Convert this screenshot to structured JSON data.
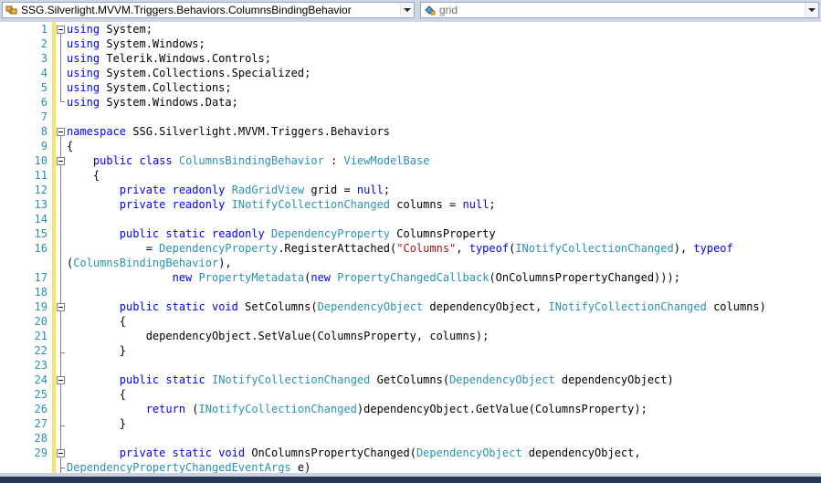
{
  "nav": {
    "type_combo": "SSG.Silverlight.MVVM.Triggers.Behaviors.ColumnsBindingBehavior",
    "member_combo": "grid"
  },
  "colors": {
    "keyword": "#0000ff",
    "type": "#2b91af",
    "string": "#a31515",
    "line_number": "#2b91af"
  },
  "lines": [
    {
      "n": "1",
      "code": [
        [
          "kw",
          "using"
        ],
        [
          "t",
          " System;"
        ]
      ]
    },
    {
      "n": "2",
      "code": [
        [
          "kw",
          "using"
        ],
        [
          "t",
          " System.Windows;"
        ]
      ]
    },
    {
      "n": "3",
      "code": [
        [
          "kw",
          "using"
        ],
        [
          "t",
          " Telerik.Windows.Controls;"
        ]
      ]
    },
    {
      "n": "4",
      "code": [
        [
          "kw",
          "using"
        ],
        [
          "t",
          " System.Collections.Specialized;"
        ]
      ]
    },
    {
      "n": "5",
      "code": [
        [
          "kw",
          "using"
        ],
        [
          "t",
          " System.Collections;"
        ]
      ]
    },
    {
      "n": "6",
      "code": [
        [
          "kw",
          "using"
        ],
        [
          "t",
          " System.Windows.Data;"
        ]
      ]
    },
    {
      "n": "7",
      "code": []
    },
    {
      "n": "8",
      "code": [
        [
          "kw",
          "namespace"
        ],
        [
          "t",
          " SSG.Silverlight.MVVM.Triggers.Behaviors"
        ]
      ]
    },
    {
      "n": "9",
      "code": [
        [
          "t",
          "{"
        ]
      ]
    },
    {
      "n": "10",
      "code": [
        [
          "t",
          "    "
        ],
        [
          "kw",
          "public"
        ],
        [
          "t",
          " "
        ],
        [
          "kw",
          "class"
        ],
        [
          "t",
          " "
        ],
        [
          "ty",
          "ColumnsBindingBehavior"
        ],
        [
          "t",
          " : "
        ],
        [
          "ty",
          "ViewModelBase"
        ]
      ]
    },
    {
      "n": "11",
      "code": [
        [
          "t",
          "    {"
        ]
      ]
    },
    {
      "n": "12",
      "code": [
        [
          "t",
          "        "
        ],
        [
          "kw",
          "private"
        ],
        [
          "t",
          " "
        ],
        [
          "kw",
          "readonly"
        ],
        [
          "t",
          " "
        ],
        [
          "ty",
          "RadGridView"
        ],
        [
          "t",
          " grid = "
        ],
        [
          "kw",
          "null"
        ],
        [
          "t",
          ";"
        ]
      ]
    },
    {
      "n": "13",
      "code": [
        [
          "t",
          "        "
        ],
        [
          "kw",
          "private"
        ],
        [
          "t",
          " "
        ],
        [
          "kw",
          "readonly"
        ],
        [
          "t",
          " "
        ],
        [
          "ty",
          "INotifyCollectionChanged"
        ],
        [
          "t",
          " columns = "
        ],
        [
          "kw",
          "null"
        ],
        [
          "t",
          ";"
        ]
      ]
    },
    {
      "n": "14",
      "code": []
    },
    {
      "n": "15",
      "code": [
        [
          "t",
          "        "
        ],
        [
          "kw",
          "public"
        ],
        [
          "t",
          " "
        ],
        [
          "kw",
          "static"
        ],
        [
          "t",
          " "
        ],
        [
          "kw",
          "readonly"
        ],
        [
          "t",
          " "
        ],
        [
          "ty",
          "DependencyProperty"
        ],
        [
          "t",
          " ColumnsProperty"
        ]
      ]
    },
    {
      "n": "16",
      "code": [
        [
          "t",
          "            = "
        ],
        [
          "ty",
          "DependencyProperty"
        ],
        [
          "t",
          ".RegisterAttached("
        ],
        [
          "st",
          "\"Columns\""
        ],
        [
          "t",
          ", "
        ],
        [
          "kw",
          "typeof"
        ],
        [
          "t",
          "("
        ],
        [
          "ty",
          "INotifyCollectionChanged"
        ],
        [
          "t",
          "), "
        ],
        [
          "kw",
          "typeof"
        ]
      ]
    },
    {
      "n": "",
      "code": [
        [
          "t",
          "("
        ],
        [
          "ty",
          "ColumnsBindingBehavior"
        ],
        [
          "t",
          "),"
        ]
      ]
    },
    {
      "n": "17",
      "code": [
        [
          "t",
          "                "
        ],
        [
          "kw",
          "new"
        ],
        [
          "t",
          " "
        ],
        [
          "ty",
          "PropertyMetadata"
        ],
        [
          "t",
          "("
        ],
        [
          "kw",
          "new"
        ],
        [
          "t",
          " "
        ],
        [
          "ty",
          "PropertyChangedCallback"
        ],
        [
          "t",
          "(OnColumnsPropertyChanged)));"
        ]
      ]
    },
    {
      "n": "18",
      "code": []
    },
    {
      "n": "19",
      "code": [
        [
          "t",
          "        "
        ],
        [
          "kw",
          "public"
        ],
        [
          "t",
          " "
        ],
        [
          "kw",
          "static"
        ],
        [
          "t",
          " "
        ],
        [
          "kw",
          "void"
        ],
        [
          "t",
          " SetColumns("
        ],
        [
          "ty",
          "DependencyObject"
        ],
        [
          "t",
          " dependencyObject, "
        ],
        [
          "ty",
          "INotifyCollectionChanged"
        ],
        [
          "t",
          " columns)"
        ]
      ]
    },
    {
      "n": "20",
      "code": [
        [
          "t",
          "        {"
        ]
      ]
    },
    {
      "n": "21",
      "code": [
        [
          "t",
          "            dependencyObject.SetValue(ColumnsProperty, columns);"
        ]
      ]
    },
    {
      "n": "22",
      "code": [
        [
          "t",
          "        }"
        ]
      ]
    },
    {
      "n": "23",
      "code": []
    },
    {
      "n": "24",
      "code": [
        [
          "t",
          "        "
        ],
        [
          "kw",
          "public"
        ],
        [
          "t",
          " "
        ],
        [
          "kw",
          "static"
        ],
        [
          "t",
          " "
        ],
        [
          "ty",
          "INotifyCollectionChanged"
        ],
        [
          "t",
          " GetColumns("
        ],
        [
          "ty",
          "DependencyObject"
        ],
        [
          "t",
          " dependencyObject)"
        ]
      ]
    },
    {
      "n": "25",
      "code": [
        [
          "t",
          "        {"
        ]
      ]
    },
    {
      "n": "26",
      "code": [
        [
          "t",
          "            "
        ],
        [
          "kw",
          "return"
        ],
        [
          "t",
          " ("
        ],
        [
          "ty",
          "INotifyCollectionChanged"
        ],
        [
          "t",
          ")dependencyObject.GetValue(ColumnsProperty);"
        ]
      ]
    },
    {
      "n": "27",
      "code": [
        [
          "t",
          "        }"
        ]
      ]
    },
    {
      "n": "28",
      "code": []
    },
    {
      "n": "29",
      "code": [
        [
          "t",
          "        "
        ],
        [
          "kw",
          "private"
        ],
        [
          "t",
          " "
        ],
        [
          "kw",
          "static"
        ],
        [
          "t",
          " "
        ],
        [
          "kw",
          "void"
        ],
        [
          "t",
          " OnColumnsPropertyChanged("
        ],
        [
          "ty",
          "DependencyObject"
        ],
        [
          "t",
          " dependencyObject,"
        ]
      ]
    },
    {
      "n": "",
      "code": [
        [
          "ty",
          "DependencyPropertyChangedEventArgs"
        ],
        [
          "t",
          " e)"
        ]
      ]
    }
  ]
}
